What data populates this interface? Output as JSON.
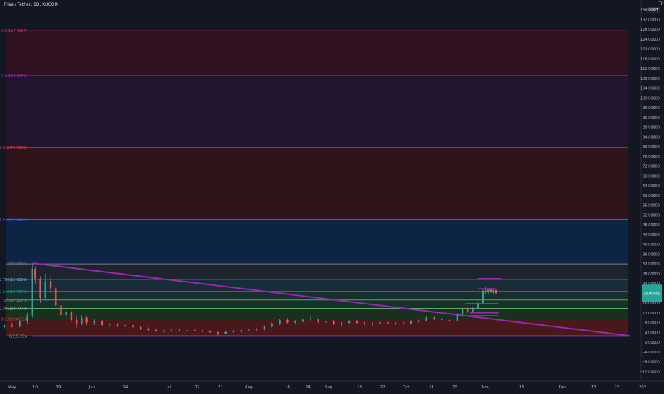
{
  "header": {
    "symbol": "Trias / Tether, 1D, KUCOIN",
    "corner": "Tr",
    "pair_badge": "USDT"
  },
  "chart_data": {
    "type": "candlestick",
    "title": "Trias / Tether, 1D, KUCOIN",
    "y_axis": {
      "min": -16,
      "max": 140,
      "ticks": [
        136,
        132,
        128,
        124,
        120,
        116,
        112,
        108,
        104,
        100,
        96,
        92,
        88,
        84,
        80,
        76,
        72,
        68,
        64,
        60,
        56,
        52,
        48,
        44,
        40,
        36,
        32,
        28,
        24,
        20,
        16,
        12,
        8,
        4,
        0,
        -4,
        -8,
        -12
      ],
      "tick_labels": [
        "136.00000",
        "132.00000",
        "128.00000",
        "124.00000",
        "120.00000",
        "116.00000",
        "112.00000",
        "108.00000",
        "104.00000",
        "100.00000",
        "96.00000",
        "92.00000",
        "88.00000",
        "84.00000",
        "80.00000",
        "76.00000",
        "72.00000",
        "68.00000",
        "64.00000",
        "60.00000",
        "56.00000",
        "52.00000",
        "48.00000",
        "44.00000",
        "40.00000",
        "36.00000",
        "32.00000",
        "28.00000",
        "24.00000",
        "20.00000",
        "16.00000",
        "12.00000",
        "8.00000",
        "4.00000",
        "0.00000",
        "−4.00000",
        "−8.00000",
        "−12.00000"
      ]
    },
    "x_axis": {
      "start_date": "2020-04-28",
      "end_date": "2021-01-01",
      "ticks": [
        {
          "date": "2020-05-01",
          "label": "May"
        },
        {
          "date": "2020-05-10",
          "label": "10"
        },
        {
          "date": "2020-05-19",
          "label": "19"
        },
        {
          "date": "2020-06-01",
          "label": "Jun"
        },
        {
          "date": "2020-06-14",
          "label": "14"
        },
        {
          "date": "2020-07-01",
          "label": "Jul"
        },
        {
          "date": "2020-07-12",
          "label": "12"
        },
        {
          "date": "2020-07-21",
          "label": "21"
        },
        {
          "date": "2020-08-01",
          "label": "Aug"
        },
        {
          "date": "2020-08-16",
          "label": "16"
        },
        {
          "date": "2020-08-24",
          "label": "24"
        },
        {
          "date": "2020-09-01",
          "label": "Sep"
        },
        {
          "date": "2020-09-13",
          "label": "13"
        },
        {
          "date": "2020-09-22",
          "label": "22"
        },
        {
          "date": "2020-10-01",
          "label": "Oct"
        },
        {
          "date": "2020-10-11",
          "label": "11"
        },
        {
          "date": "2020-10-20",
          "label": "20"
        },
        {
          "date": "2020-11-01",
          "label": "Nov"
        },
        {
          "date": "2020-11-15",
          "label": "15"
        },
        {
          "date": "2020-12-01",
          "label": "Dec"
        },
        {
          "date": "2020-12-13",
          "label": "13"
        },
        {
          "date": "2020-12-22",
          "label": "22"
        },
        {
          "date": "2021-01-01",
          "label": "202"
        }
      ]
    },
    "price_label": {
      "value": 20.0,
      "text": "20.00000",
      "color": "#26a69a"
    },
    "fib_levels": [
      {
        "ratio": "0",
        "price": 2.5,
        "label": "0(2.5(39))",
        "color": "#9598a1",
        "fill": "#5c1a1a"
      },
      {
        "ratio": "0.236",
        "price": 9.47,
        "label": "0.236(9.47(2))",
        "color": "#f23645",
        "fill": "#1e3a1f"
      },
      {
        "ratio": "0.382",
        "price": 13.77,
        "label": "0.382(13.7770)",
        "color": "#81c784",
        "fill": "#183b2c"
      },
      {
        "ratio": "0.5",
        "price": 17.25,
        "label": "0.5(17.2570)",
        "color": "#4caf50",
        "fill": "#17392f"
      },
      {
        "ratio": "0.618",
        "price": 20.73,
        "label": "0.618(20.7370)",
        "color": "#089981",
        "fill": "#1a3540"
      },
      {
        "ratio": "0.786",
        "price": 25.69,
        "label": "0.786(25.6899)",
        "color": "#64b5f6",
        "fill": "#232a33"
      },
      {
        "ratio": "1",
        "price": 32.0,
        "label": "1(32.0000)",
        "color": "#787b86",
        "fill": "#0d2a52"
      },
      {
        "ratio": "1.618",
        "price": 50.22,
        "label": "1.618(50.2229)",
        "color": "#2962ff",
        "fill": "#3a1418"
      },
      {
        "ratio": "2.618",
        "price": 79.7,
        "label": "2.618(79.7006)",
        "color": "#f23645",
        "fill": "#2a1536"
      },
      {
        "ratio": "3.618",
        "price": 109.15,
        "label": "3.618(109.1543)",
        "color": "#9c27b0",
        "fill": "#3b1020"
      },
      {
        "ratio": "4.236",
        "price": 127.42,
        "label": "4.236(127.4167)",
        "color": "#e91e63",
        "fill": null
      }
    ],
    "trendlines": [
      {
        "from": {
          "date": "2020-05-09",
          "price": 32.3
        },
        "to": {
          "date": "2020-12-27",
          "price": 2.6
        },
        "color": "#9c27b0"
      },
      {
        "from": {
          "date": "2020-05-09",
          "price": 2.5
        },
        "to": {
          "date": "2020-12-27",
          "price": 2.5
        },
        "color": "#9c27b0"
      }
    ],
    "marker_lines": [
      {
        "from": "2020-10-29",
        "to": "2020-11-07",
        "price": 26.0,
        "color": "#9c27b0"
      },
      {
        "from": "2020-10-29",
        "to": "2020-11-05",
        "price": 21.8,
        "color": "#9c27b0"
      },
      {
        "from": "2020-10-24",
        "to": "2020-11-06",
        "price": 15.8,
        "color": "#9c27b0"
      },
      {
        "from": "2020-10-26",
        "to": "2020-11-06",
        "price": 12.0,
        "color": "#9c27b0"
      },
      {
        "from": "2020-10-24",
        "to": "2020-11-06",
        "price": 10.8,
        "color": "#9c27b0"
      }
    ],
    "candles": [
      {
        "date": "2020-04-28",
        "o": 6.0,
        "h": 7.5,
        "l": 5.5,
        "c": 7.0
      },
      {
        "date": "2020-05-01",
        "o": 7.0,
        "h": 8.0,
        "l": 6.0,
        "c": 6.5
      },
      {
        "date": "2020-05-04",
        "o": 6.5,
        "h": 9.0,
        "l": 6.0,
        "c": 8.5
      },
      {
        "date": "2020-05-07",
        "o": 8.5,
        "h": 12.0,
        "l": 7.5,
        "c": 11.0
      },
      {
        "date": "2020-05-09",
        "o": 11.0,
        "h": 32.3,
        "l": 10.0,
        "c": 30.0
      },
      {
        "date": "2020-05-10",
        "o": 30.0,
        "h": 31.0,
        "l": 24.0,
        "c": 26.0
      },
      {
        "date": "2020-05-12",
        "o": 26.0,
        "h": 27.0,
        "l": 16.0,
        "c": 18.0
      },
      {
        "date": "2020-05-14",
        "o": 18.0,
        "h": 28.0,
        "l": 17.0,
        "c": 25.0
      },
      {
        "date": "2020-05-16",
        "o": 25.0,
        "h": 27.0,
        "l": 20.0,
        "c": 22.0
      },
      {
        "date": "2020-05-18",
        "o": 22.0,
        "h": 23.0,
        "l": 14.0,
        "c": 15.0
      },
      {
        "date": "2020-05-20",
        "o": 15.0,
        "h": 16.0,
        "l": 10.0,
        "c": 11.0
      },
      {
        "date": "2020-05-22",
        "o": 11.0,
        "h": 14.0,
        "l": 9.0,
        "c": 12.5
      },
      {
        "date": "2020-05-24",
        "o": 12.5,
        "h": 13.0,
        "l": 8.0,
        "c": 9.0
      },
      {
        "date": "2020-05-26",
        "o": 9.0,
        "h": 11.0,
        "l": 6.0,
        "c": 7.5
      },
      {
        "date": "2020-05-28",
        "o": 7.5,
        "h": 11.0,
        "l": 7.0,
        "c": 10.0
      },
      {
        "date": "2020-05-30",
        "o": 10.0,
        "h": 10.5,
        "l": 7.0,
        "c": 8.0
      },
      {
        "date": "2020-06-02",
        "o": 8.0,
        "h": 9.5,
        "l": 7.0,
        "c": 8.5
      },
      {
        "date": "2020-06-05",
        "o": 8.5,
        "h": 9.0,
        "l": 6.5,
        "c": 7.0
      },
      {
        "date": "2020-06-08",
        "o": 7.0,
        "h": 8.0,
        "l": 6.0,
        "c": 7.5
      },
      {
        "date": "2020-06-11",
        "o": 7.5,
        "h": 8.0,
        "l": 6.0,
        "c": 6.5
      },
      {
        "date": "2020-06-14",
        "o": 6.5,
        "h": 7.5,
        "l": 6.0,
        "c": 7.0
      },
      {
        "date": "2020-06-17",
        "o": 7.0,
        "h": 7.5,
        "l": 5.5,
        "c": 6.0
      },
      {
        "date": "2020-06-20",
        "o": 6.0,
        "h": 6.5,
        "l": 5.0,
        "c": 5.5
      },
      {
        "date": "2020-06-23",
        "o": 5.5,
        "h": 6.0,
        "l": 4.5,
        "c": 5.0
      },
      {
        "date": "2020-06-26",
        "o": 5.0,
        "h": 5.5,
        "l": 4.2,
        "c": 4.5
      },
      {
        "date": "2020-06-29",
        "o": 4.5,
        "h": 5.0,
        "l": 4.0,
        "c": 4.6
      },
      {
        "date": "2020-07-02",
        "o": 4.6,
        "h": 5.2,
        "l": 4.2,
        "c": 4.8
      },
      {
        "date": "2020-07-05",
        "o": 4.8,
        "h": 5.3,
        "l": 4.4,
        "c": 4.7
      },
      {
        "date": "2020-07-08",
        "o": 4.7,
        "h": 5.1,
        "l": 4.3,
        "c": 4.9
      },
      {
        "date": "2020-07-11",
        "o": 4.9,
        "h": 5.2,
        "l": 4.4,
        "c": 4.6
      },
      {
        "date": "2020-07-14",
        "o": 4.6,
        "h": 5.0,
        "l": 4.0,
        "c": 4.4
      },
      {
        "date": "2020-07-17",
        "o": 4.4,
        "h": 4.8,
        "l": 3.8,
        "c": 4.0
      },
      {
        "date": "2020-07-20",
        "o": 4.0,
        "h": 4.5,
        "l": 2.6,
        "c": 3.4
      },
      {
        "date": "2020-07-23",
        "o": 3.4,
        "h": 4.5,
        "l": 3.2,
        "c": 4.2
      },
      {
        "date": "2020-07-26",
        "o": 4.2,
        "h": 4.9,
        "l": 3.9,
        "c": 4.5
      },
      {
        "date": "2020-07-29",
        "o": 4.5,
        "h": 5.0,
        "l": 4.0,
        "c": 4.8
      },
      {
        "date": "2020-08-01",
        "o": 4.8,
        "h": 5.5,
        "l": 4.4,
        "c": 5.2
      },
      {
        "date": "2020-08-04",
        "o": 5.2,
        "h": 5.8,
        "l": 4.6,
        "c": 5.0
      },
      {
        "date": "2020-08-07",
        "o": 5.0,
        "h": 7.0,
        "l": 4.8,
        "c": 6.5
      },
      {
        "date": "2020-08-10",
        "o": 6.5,
        "h": 8.0,
        "l": 6.0,
        "c": 7.5
      },
      {
        "date": "2020-08-13",
        "o": 7.5,
        "h": 9.5,
        "l": 7.0,
        "c": 9.0
      },
      {
        "date": "2020-08-16",
        "o": 9.0,
        "h": 9.8,
        "l": 7.5,
        "c": 8.0
      },
      {
        "date": "2020-08-19",
        "o": 8.0,
        "h": 9.0,
        "l": 7.2,
        "c": 8.5
      },
      {
        "date": "2020-08-22",
        "o": 8.5,
        "h": 9.5,
        "l": 8.0,
        "c": 9.2
      },
      {
        "date": "2020-08-25",
        "o": 9.2,
        "h": 10.5,
        "l": 8.5,
        "c": 9.5
      },
      {
        "date": "2020-08-28",
        "o": 9.5,
        "h": 9.8,
        "l": 7.5,
        "c": 8.0
      },
      {
        "date": "2020-08-31",
        "o": 8.0,
        "h": 8.8,
        "l": 7.2,
        "c": 8.4
      },
      {
        "date": "2020-09-03",
        "o": 8.4,
        "h": 9.0,
        "l": 7.0,
        "c": 7.5
      },
      {
        "date": "2020-09-06",
        "o": 7.5,
        "h": 8.2,
        "l": 6.8,
        "c": 7.8
      },
      {
        "date": "2020-09-09",
        "o": 7.8,
        "h": 9.0,
        "l": 7.3,
        "c": 8.6
      },
      {
        "date": "2020-09-12",
        "o": 8.6,
        "h": 9.0,
        "l": 7.4,
        "c": 7.8
      },
      {
        "date": "2020-09-15",
        "o": 7.8,
        "h": 8.4,
        "l": 7.0,
        "c": 7.4
      },
      {
        "date": "2020-09-18",
        "o": 7.4,
        "h": 8.0,
        "l": 6.8,
        "c": 7.6
      },
      {
        "date": "2020-09-21",
        "o": 7.6,
        "h": 8.6,
        "l": 7.2,
        "c": 8.2
      },
      {
        "date": "2020-09-24",
        "o": 8.2,
        "h": 8.6,
        "l": 7.2,
        "c": 7.5
      },
      {
        "date": "2020-09-27",
        "o": 7.5,
        "h": 8.2,
        "l": 7.0,
        "c": 7.8
      },
      {
        "date": "2020-09-30",
        "o": 7.8,
        "h": 8.3,
        "l": 7.2,
        "c": 7.6
      },
      {
        "date": "2020-10-03",
        "o": 7.6,
        "h": 9.0,
        "l": 7.3,
        "c": 8.6
      },
      {
        "date": "2020-10-06",
        "o": 8.6,
        "h": 9.2,
        "l": 8.0,
        "c": 8.8
      },
      {
        "date": "2020-10-09",
        "o": 8.8,
        "h": 10.5,
        "l": 8.5,
        "c": 10.0
      },
      {
        "date": "2020-10-12",
        "o": 10.0,
        "h": 10.4,
        "l": 9.0,
        "c": 9.4
      },
      {
        "date": "2020-10-15",
        "o": 9.4,
        "h": 9.8,
        "l": 8.6,
        "c": 9.0
      },
      {
        "date": "2020-10-18",
        "o": 9.0,
        "h": 9.5,
        "l": 8.2,
        "c": 8.6
      },
      {
        "date": "2020-10-21",
        "o": 8.6,
        "h": 12.0,
        "l": 8.4,
        "c": 11.5
      },
      {
        "date": "2020-10-23",
        "o": 11.5,
        "h": 14.5,
        "l": 10.8,
        "c": 13.8
      },
      {
        "date": "2020-10-25",
        "o": 13.8,
        "h": 14.2,
        "l": 12.0,
        "c": 12.6
      },
      {
        "date": "2020-10-27",
        "o": 12.6,
        "h": 14.5,
        "l": 12.2,
        "c": 14.0
      },
      {
        "date": "2020-10-29",
        "o": 14.0,
        "h": 16.5,
        "l": 13.5,
        "c": 16.0
      },
      {
        "date": "2020-10-31",
        "o": 16.0,
        "h": 22.0,
        "l": 15.5,
        "c": 21.0
      },
      {
        "date": "2020-11-01",
        "o": 21.0,
        "h": 22.5,
        "l": 19.5,
        "c": 20.5
      },
      {
        "date": "2020-11-02",
        "o": 20.5,
        "h": 22.0,
        "l": 19.5,
        "c": 21.5
      },
      {
        "date": "2020-11-03",
        "o": 21.5,
        "h": 22.2,
        "l": 20.0,
        "c": 20.6
      },
      {
        "date": "2020-11-04",
        "o": 20.6,
        "h": 21.8,
        "l": 19.8,
        "c": 21.2
      },
      {
        "date": "2020-11-05",
        "o": 21.2,
        "h": 21.6,
        "l": 19.8,
        "c": 20.0
      }
    ]
  }
}
